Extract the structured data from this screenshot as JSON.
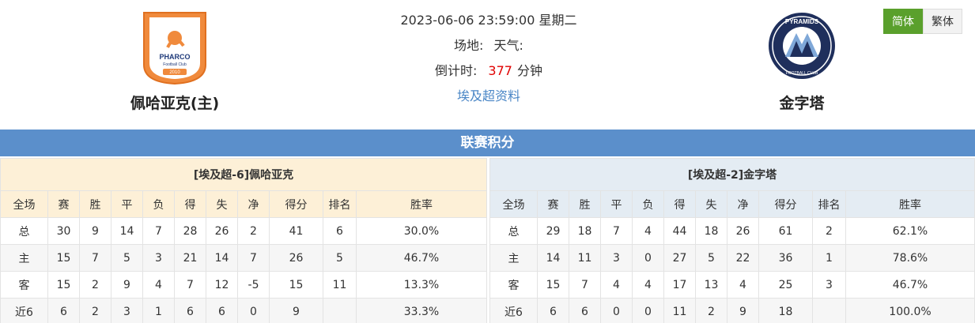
{
  "home_team": {
    "name": "佩哈亚克(主)",
    "logo_text": "PHARCO",
    "logo_sub": "Football Club",
    "logo_year": "2010"
  },
  "away_team": {
    "name": "金字塔",
    "logo_text": "PYRAMIDS",
    "logo_sub": "FOOTBALL CLUB"
  },
  "match": {
    "datetime": "2023-06-06 23:59:00 星期二",
    "venue_label": "场地:",
    "weather_label": "天气:",
    "countdown_label": "倒计时:",
    "countdown_value": "377",
    "countdown_unit": "分钟",
    "league_link": "埃及超资料"
  },
  "lang": {
    "simplified": "简体",
    "traditional": "繁体"
  },
  "banner": "联赛积分",
  "columns": [
    "全场",
    "赛",
    "胜",
    "平",
    "负",
    "得",
    "失",
    "净",
    "得分",
    "排名",
    "胜率"
  ],
  "home_standings": {
    "title": "[埃及超-6]佩哈亚克",
    "rows": [
      [
        "总",
        "30",
        "9",
        "14",
        "7",
        "28",
        "26",
        "2",
        "41",
        "6",
        "30.0%"
      ],
      [
        "主",
        "15",
        "7",
        "5",
        "3",
        "21",
        "14",
        "7",
        "26",
        "5",
        "46.7%"
      ],
      [
        "客",
        "15",
        "2",
        "9",
        "4",
        "7",
        "12",
        "-5",
        "15",
        "11",
        "13.3%"
      ],
      [
        "近6",
        "6",
        "2",
        "3",
        "1",
        "6",
        "6",
        "0",
        "9",
        "",
        "33.3%"
      ]
    ]
  },
  "away_standings": {
    "title": "[埃及超-2]金字塔",
    "rows": [
      [
        "总",
        "29",
        "18",
        "7",
        "4",
        "44",
        "18",
        "26",
        "61",
        "2",
        "62.1%"
      ],
      [
        "主",
        "14",
        "11",
        "3",
        "0",
        "27",
        "5",
        "22",
        "36",
        "1",
        "78.6%"
      ],
      [
        "客",
        "15",
        "7",
        "4",
        "4",
        "17",
        "13",
        "4",
        "25",
        "3",
        "46.7%"
      ],
      [
        "近6",
        "6",
        "6",
        "0",
        "0",
        "11",
        "2",
        "9",
        "18",
        "",
        "100.0%"
      ]
    ]
  },
  "colors": {
    "banner": "#5b8fcb",
    "accent_green": "#5aa02c",
    "countdown": "#e00000",
    "link": "#4a86c6"
  }
}
